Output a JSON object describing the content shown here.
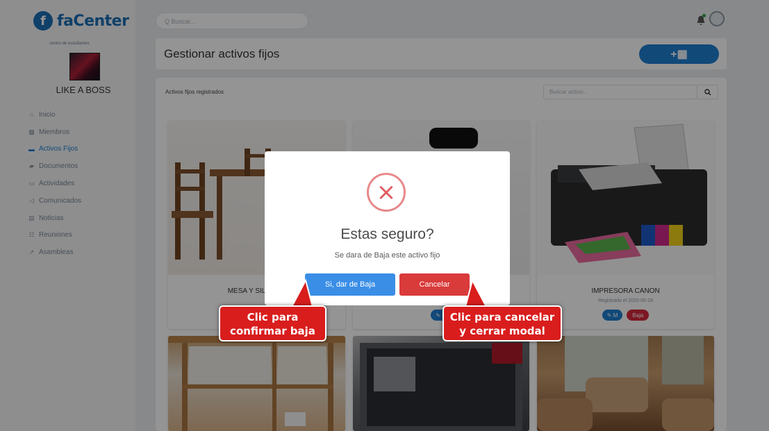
{
  "app": {
    "name": "faCenter",
    "logo_letter": "f"
  },
  "org": {
    "subtitle": "centro de estudiantes",
    "name": "LIKE A BOSS"
  },
  "sidebar": {
    "items": [
      {
        "label": "Inicio",
        "icon": "home-icon",
        "glyph": "⌂"
      },
      {
        "label": "Miembros",
        "icon": "members-icon",
        "glyph": "▦"
      },
      {
        "label": "Activos Fijos",
        "icon": "assets-icon",
        "glyph": "▬",
        "active": true
      },
      {
        "label": "Documentos",
        "icon": "folder-icon",
        "glyph": "▰"
      },
      {
        "label": "Actividades",
        "icon": "calendar-icon",
        "glyph": "▭"
      },
      {
        "label": "Comunicados",
        "icon": "megaphone-icon",
        "glyph": "◁"
      },
      {
        "label": "Noticias",
        "icon": "news-icon",
        "glyph": "▤"
      },
      {
        "label": "Reuniones",
        "icon": "meeting-icon",
        "glyph": "☷"
      },
      {
        "label": "Asambleas",
        "icon": "assembly-icon",
        "glyph": "➚"
      }
    ]
  },
  "topbar": {
    "search_placeholder": "Q Buscar..."
  },
  "header": {
    "title": "Gestionar activos fijos",
    "add_label": "+▦"
  },
  "content": {
    "section_label": "Activos fijos registrados",
    "search_placeholder": "Buscar activo...",
    "search_icon": "🔍"
  },
  "assets": [
    {
      "name": "MESA Y SILLAS D",
      "image": "table-chairs"
    },
    {
      "name": "",
      "image": "office-chair",
      "mod": "✎ M"
    },
    {
      "name": "IMPRESORA CANON",
      "date": "Registrado el 2020-05-28",
      "image": "printer",
      "mod": "✎ M",
      "baja": "Baja"
    },
    {
      "image": "shelf"
    },
    {
      "image": "tv"
    },
    {
      "image": "living-room"
    }
  ],
  "modal": {
    "icon": "×",
    "title": "Estas seguro?",
    "text": "Se dara de Baja este activo fijo",
    "confirm_label": "Si, dar de Baja",
    "cancel_label": "Cancelar"
  },
  "callouts": {
    "confirm": {
      "line1": "Clic para",
      "line2": "confirmar baja"
    },
    "cancel": {
      "line1": "Clic para cancelar",
      "line2": "y cerrar modal"
    }
  },
  "colors": {
    "brand": "#1a6fb5",
    "primary": "#1e7fd1",
    "danger": "#d6283c",
    "callout": "#d91d1d"
  }
}
